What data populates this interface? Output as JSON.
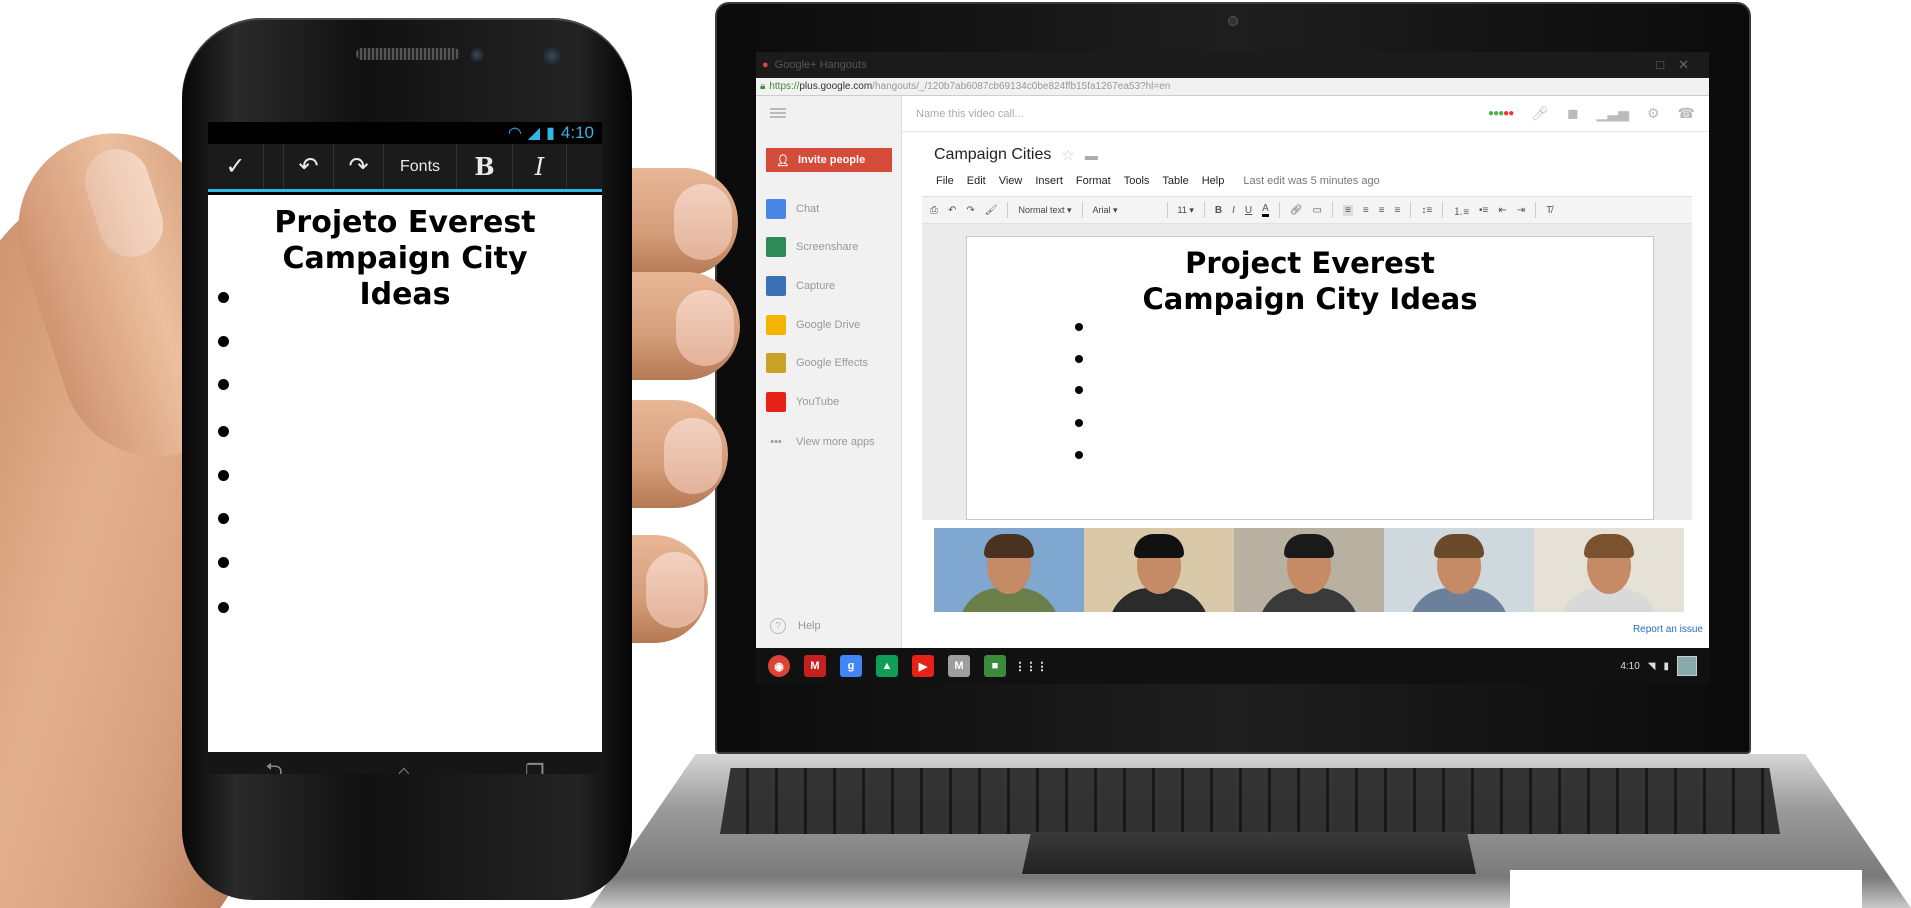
{
  "phone": {
    "status": {
      "time": "4:10"
    },
    "actionbar": {
      "done_icon": "check-icon",
      "undo_icon": "undo-icon",
      "redo_icon": "redo-icon",
      "fonts_label": "Fonts",
      "bold_label": "B",
      "italic_label": "I"
    },
    "document": {
      "title": [
        "Projeto Everest",
        "Campaign City",
        "Ideas"
      ],
      "empty_bullets": 8
    }
  },
  "laptop": {
    "window_title": "Google+ Hangouts",
    "url": {
      "scheme": "https://",
      "host": "plus.google.com",
      "path": "/hangouts/_/120b7ab6087cb69134c0be824ffb15fa1267ea53?hl=en"
    },
    "call_name_placeholder": "Name this video call...",
    "sidebar": {
      "invite_label": "Invite people",
      "apps": [
        {
          "label": "Chat",
          "icon": "chat-icon",
          "color": "#4a86e8"
        },
        {
          "label": "Screenshare",
          "icon": "screenshare-icon",
          "color": "#2e8b57"
        },
        {
          "label": "Capture",
          "icon": "camera-icon",
          "color": "#3d6fb6"
        },
        {
          "label": "Google Drive",
          "icon": "drive-icon",
          "color": "#f4b400"
        },
        {
          "label": "Google Effects",
          "icon": "effects-icon",
          "color": "#c9a227"
        },
        {
          "label": "YouTube",
          "icon": "youtube-icon",
          "color": "#e62117"
        },
        {
          "label": "View more apps",
          "icon": "more-icon",
          "color": "#999999"
        }
      ],
      "help_label": "Help"
    },
    "doc": {
      "name": "Campaign Cities",
      "menu": [
        "File",
        "Edit",
        "View",
        "Insert",
        "Format",
        "Tools",
        "Table",
        "Help"
      ],
      "last_edit": "Last edit was 5 minutes ago",
      "toolbar": {
        "style": "Normal text",
        "font": "Arial",
        "size": "11",
        "bold": "B",
        "italic": "I",
        "underline": "U",
        "text_color": "A"
      },
      "title": [
        "Project Everest",
        "Campaign City Ideas"
      ],
      "empty_bullets": 5
    },
    "participants": [
      {
        "name": "participant-1",
        "bg": "#7fa7d0",
        "shirt": "#6b7f4a",
        "hair": "#4a3220"
      },
      {
        "name": "participant-2",
        "bg": "#d9c9a8",
        "shirt": "#2b2b2b",
        "hair": "#111111"
      },
      {
        "name": "participant-3",
        "bg": "#b8b0a0",
        "shirt": "#3a3a3a",
        "hair": "#1a1a1a"
      },
      {
        "name": "participant-4",
        "bg": "#cfd8dd",
        "shirt": "#6c7f9b",
        "hair": "#6a4a2a"
      },
      {
        "name": "participant-5",
        "bg": "#e6e1d6",
        "shirt": "#d9d9d9",
        "hair": "#7a5230"
      }
    ],
    "report_issue": "Report an issue",
    "shelf": {
      "apps": [
        {
          "name": "chrome-icon",
          "color": "#db4437",
          "glyph": "◉"
        },
        {
          "name": "gmail-icon",
          "color": "#c5221f",
          "glyph": "M"
        },
        {
          "name": "google-search-icon",
          "color": "#4285f4",
          "glyph": "g"
        },
        {
          "name": "drive-icon",
          "color": "#0f9d58",
          "glyph": "▲"
        },
        {
          "name": "youtube-icon",
          "color": "#e62117",
          "glyph": "▶"
        },
        {
          "name": "mail-icon",
          "color": "#9e9e9e",
          "glyph": "M"
        },
        {
          "name": "hangouts-icon",
          "color": "#3c8b3c",
          "glyph": "■"
        },
        {
          "name": "app-launcher-icon",
          "color": "#111111",
          "glyph": "⋮⋮⋮"
        }
      ],
      "time": "4:10"
    }
  }
}
